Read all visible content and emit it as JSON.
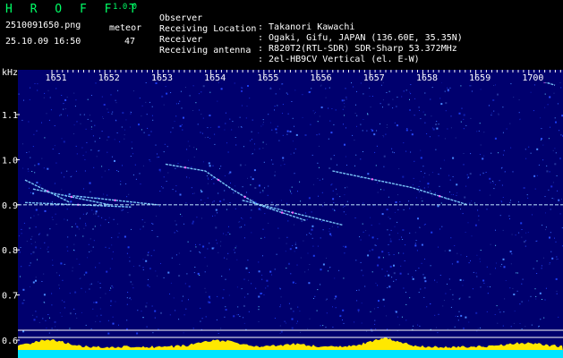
{
  "header": {
    "app_title": "H R O F F T",
    "app_version": "1.0.0",
    "filename": "2510091650.png",
    "datetime": "25.10.09 16:50",
    "event_type_label": "meteor",
    "event_count": "47"
  },
  "info": [
    {
      "key": "Observer",
      "value": ": Takanori Kawachi"
    },
    {
      "key": "Receiving Location",
      "value": ": Ogaki, Gifu, JAPAN (136.60E, 35.35N)"
    },
    {
      "key": "Receiver",
      "value": ": R820T2(RTL-SDR) SDR-Sharp 53.372MHz"
    },
    {
      "key": "Receiving antenna",
      "value": ": 2el-HB9CV Vertical (el. E-W)"
    }
  ],
  "colors": {
    "header_green": "#00ff66",
    "background": "#00006e",
    "signal_line": "#7fd0ff",
    "baseline_yellow": "#ffe800",
    "bottom_band": "#00e5ff"
  },
  "chart_data": {
    "type": "heatmap",
    "title": "",
    "xlabel": "",
    "ylabel": "kHz",
    "x_ticks": [
      "1651",
      "1652",
      "1653",
      "1654",
      "1655",
      "1656",
      "1657",
      "1658",
      "1659",
      "1700"
    ],
    "y_ticks": [
      "1.1",
      "1.0",
      "0.9",
      "0.8",
      "0.7",
      "0.6"
    ],
    "ylim": [
      0.6,
      1.17
    ],
    "xlim_minutes": [
      0,
      10
    ],
    "grid": false,
    "carrier_khz": 0.9,
    "meteor_traces": [
      {
        "points": [
          [
            0.0,
            0.955
          ],
          [
            0.85,
            0.905
          ]
        ]
      },
      {
        "points": [
          [
            0.15,
            0.935
          ],
          [
            1.6,
            0.9
          ]
        ]
      },
      {
        "points": [
          [
            0.9,
            0.92
          ],
          [
            2.5,
            0.9
          ]
        ]
      },
      {
        "points": [
          [
            2.65,
            0.99
          ],
          [
            3.4,
            0.975
          ],
          [
            3.9,
            0.935
          ],
          [
            4.4,
            0.9
          ],
          [
            5.3,
            0.865
          ]
        ]
      },
      {
        "points": [
          [
            4.1,
            0.91
          ],
          [
            6.0,
            0.855
          ]
        ]
      },
      {
        "points": [
          [
            5.8,
            0.975
          ],
          [
            7.3,
            0.938
          ],
          [
            8.35,
            0.9
          ]
        ]
      },
      {
        "points": [
          [
            0.0,
            0.905
          ],
          [
            2.0,
            0.895
          ]
        ]
      },
      {
        "points": [
          [
            9.6,
            1.18
          ],
          [
            10.0,
            1.165
          ]
        ]
      }
    ]
  }
}
